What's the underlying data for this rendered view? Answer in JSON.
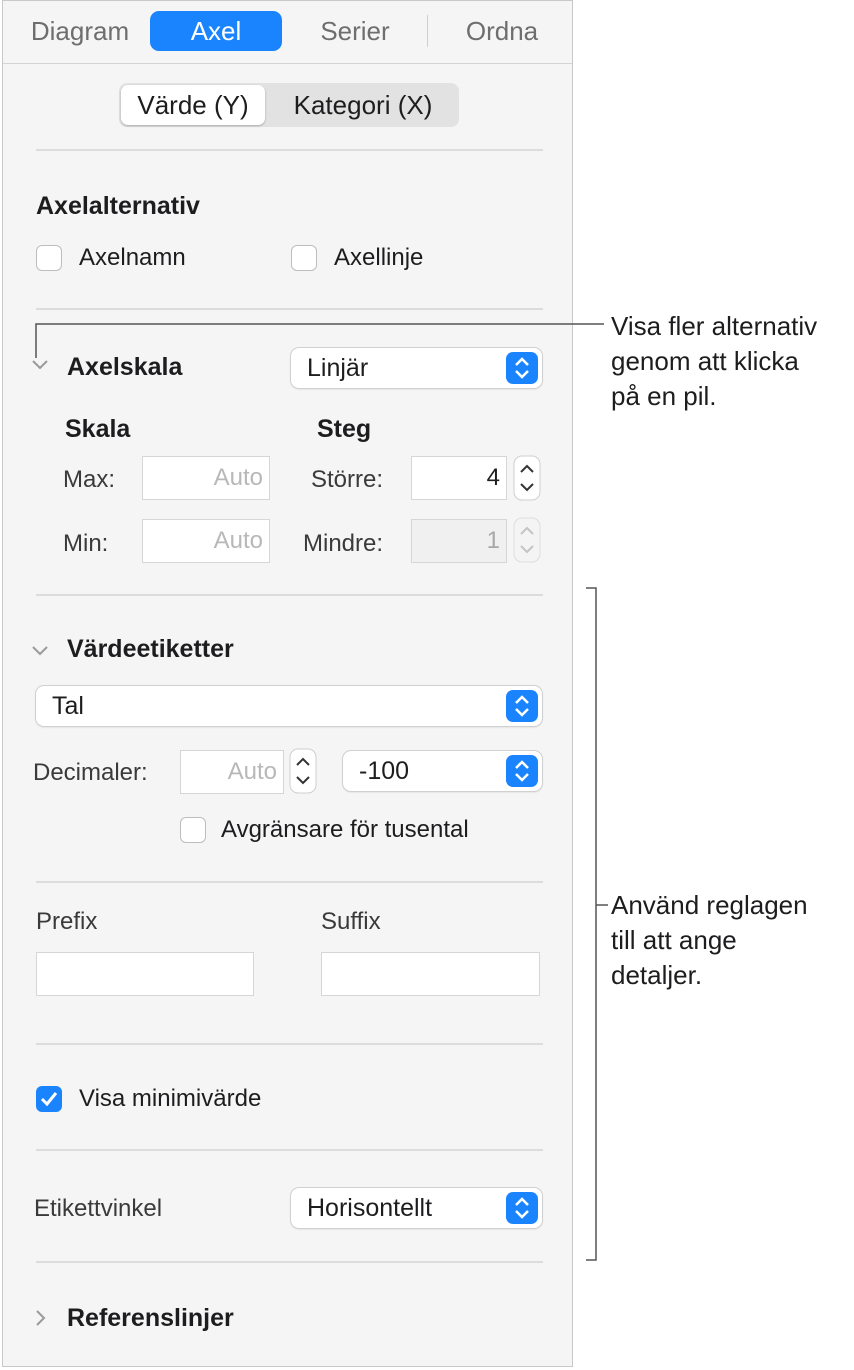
{
  "tabs": [
    "Diagram",
    "Axel",
    "Serier",
    "Ordna"
  ],
  "segment": {
    "value_y": "Värde (Y)",
    "category_x": "Kategori (X)"
  },
  "axis_options": {
    "title": "Axelalternativ",
    "axis_name": "Axelnamn",
    "axis_line": "Axellinje"
  },
  "axis_scale": {
    "title": "Axelskala",
    "scale_type": "Linjär"
  },
  "scale": {
    "title": "Skala",
    "max_label": "Max:",
    "max_value": "Auto",
    "min_label": "Min:",
    "min_value": "Auto"
  },
  "steps": {
    "title": "Steg",
    "major_label": "Större:",
    "major_value": "4",
    "minor_label": "Mindre:",
    "minor_value": "1"
  },
  "value_labels": {
    "title": "Värdeetiketter",
    "format": "Tal",
    "decimals_label": "Decimaler:",
    "decimals_value": "Auto",
    "negative_format": "-100",
    "thousands_separator": "Avgränsare för tusental"
  },
  "prefix_suffix": {
    "prefix": "Prefix",
    "suffix": "Suffix",
    "prefix_value": "",
    "suffix_value": ""
  },
  "show_minimum": {
    "label": "Visa minimivärde",
    "checked": true
  },
  "label_angle": {
    "label": "Etikettvinkel",
    "value": "Horisontellt"
  },
  "reference_lines": {
    "title": "Referenslinjer"
  },
  "callouts": {
    "arrow_line1": "Visa fler alternativ",
    "arrow_line2": "genom att klicka",
    "arrow_line3": "på en pil.",
    "controls_line1": "Använd reglagen",
    "controls_line2": "till att ange",
    "controls_line3": "detaljer."
  },
  "colors": {
    "accent": "#1a84ff",
    "panel_bg": "#f5f5f5"
  }
}
